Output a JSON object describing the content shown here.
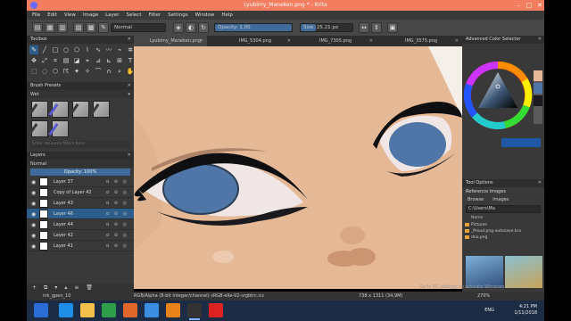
{
  "window": {
    "title": "Lyubimy_Maneken.png * - Krita"
  },
  "menu": [
    "File",
    "Edit",
    "View",
    "Image",
    "Layer",
    "Select",
    "Filter",
    "Settings",
    "Window",
    "Help"
  ],
  "toolbar": {
    "blend_mode": "Normal",
    "opacity_label": "Opacity:  1.00",
    "size_label": "Size:  25.21 px",
    "opacity_fraction": 1.0
  },
  "toolbox": {
    "title": "Toolbox"
  },
  "brush_presets": {
    "title": "Brush Presets",
    "filter": "Wet",
    "search_placeholder": "Enter resource filters here"
  },
  "layers": {
    "title": "Layers",
    "blend_mode": "Normal",
    "opacity_label": "Opacity:  100%",
    "items": [
      {
        "name": "Layer 37",
        "selected": false
      },
      {
        "name": "Copy of Layer 42",
        "selected": false
      },
      {
        "name": "Layer 43",
        "selected": false
      },
      {
        "name": "Layer 46",
        "selected": true
      },
      {
        "name": "Layer 44",
        "selected": false
      },
      {
        "name": "Layer 42",
        "selected": false
      },
      {
        "name": "Layer 41",
        "selected": false
      }
    ]
  },
  "tabs": [
    {
      "label": "Lyubimy_Maneken.png",
      "active": true
    },
    {
      "label": "IMG_5304.png",
      "active": false
    },
    {
      "label": "IMG_7305.png",
      "active": false
    },
    {
      "label": "IMG_3575.png",
      "active": false
    }
  ],
  "color_selector": {
    "title": "Advanced Color Selector"
  },
  "tool_options": {
    "title": "Tool Options"
  },
  "reference_images": {
    "title": "Reference Images",
    "tab_browse": "Browse",
    "tab_images": "Images",
    "path": "C:\\Users\\Ma",
    "column_name": "Name",
    "items": [
      "Pictures",
      "_Proud.png-autosave.kra",
      "dno.png"
    ]
  },
  "statusbar": {
    "brush": "ink_gpen_10",
    "colorspace": "RGB/Alpha (8-bit integer/channel)  sRGB-elle-V2-srgbtrc.icc",
    "dimensions": "738 x 1311 (34,9M)",
    "zoom": "270%",
    "watermark": "Go to PC settings to activate Windows."
  },
  "taskbar": {
    "lang": "ENG",
    "time": "4:21 PM",
    "date": "1/11/2018"
  },
  "colors": {
    "title_bar": "#f27e5f",
    "selection": "#2d5d8a",
    "skin": "#e5b896",
    "iris": "#4f76a6"
  }
}
